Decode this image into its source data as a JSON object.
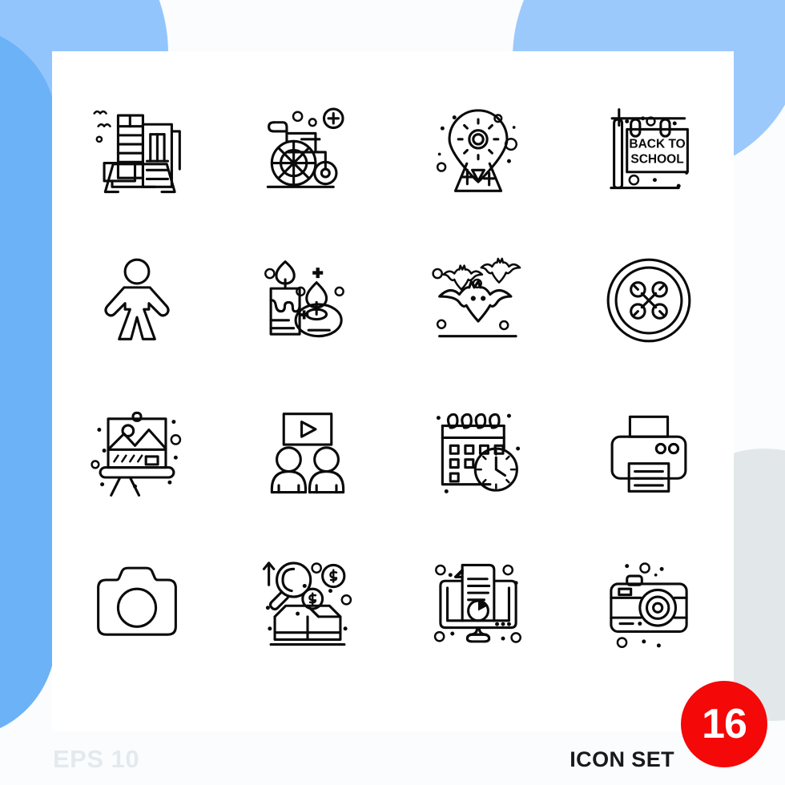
{
  "poster": {
    "footer": {
      "eps_label": "EPS 10",
      "set_label": "ICON SET",
      "count_badge": "16"
    },
    "colors": {
      "sheet": "#ffffff",
      "page_background": "#fbfcfd",
      "blob_light_blue": "#93c5fd",
      "blob_blue": "#6cb2f7",
      "blob_top_right": "#9cc9fc",
      "blob_grey": "#e2e8ea",
      "icon_stroke": "#0a0a0a",
      "badge_red": "#f40808",
      "eps_text": "#e4e9ee",
      "set_text": "#19191c"
    }
  },
  "grid": {
    "rows": 4,
    "columns": 4,
    "icons": [
      {
        "index": 1,
        "name": "buildings-icon",
        "label": "Buildings"
      },
      {
        "index": 2,
        "name": "wheelchair-icon",
        "label": "Wheelchair"
      },
      {
        "index": 3,
        "name": "location-settings-icon",
        "label": "Location Settings"
      },
      {
        "index": 4,
        "name": "back-to-school-sign-icon",
        "label": "Back To School Sign",
        "sign_line1": "BACK TO",
        "sign_line2": "SCHOOL"
      },
      {
        "index": 5,
        "name": "person-icon",
        "label": "Person"
      },
      {
        "index": 6,
        "name": "candles-icon",
        "label": "Candles"
      },
      {
        "index": 7,
        "name": "bats-icon",
        "label": "Bats"
      },
      {
        "index": 8,
        "name": "sewing-button-icon",
        "label": "Button"
      },
      {
        "index": 9,
        "name": "easel-painting-icon",
        "label": "Easel"
      },
      {
        "index": 10,
        "name": "video-presentation-icon",
        "label": "Video Presentation"
      },
      {
        "index": 11,
        "name": "calendar-clock-icon",
        "label": "Schedule"
      },
      {
        "index": 12,
        "name": "printer-icon",
        "label": "Printer"
      },
      {
        "index": 13,
        "name": "camera-icon",
        "label": "Camera"
      },
      {
        "index": 14,
        "name": "product-research-icon",
        "label": "Product Research"
      },
      {
        "index": 15,
        "name": "online-report-icon",
        "label": "Online Report"
      },
      {
        "index": 16,
        "name": "photo-camera-icon",
        "label": "Photo Camera"
      }
    ]
  }
}
